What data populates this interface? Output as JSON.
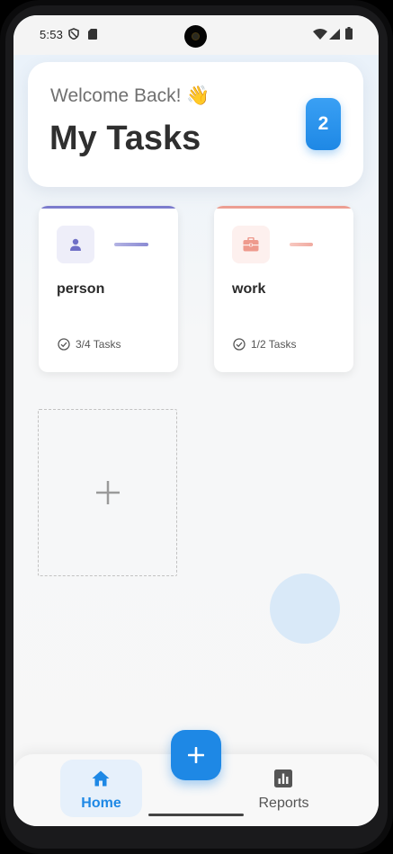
{
  "status_bar": {
    "time": "5:53",
    "left_icons": [
      "shield-icon",
      "sim-card-icon"
    ],
    "right_icons": [
      "wifi-icon",
      "cellular-signal-icon",
      "battery-icon"
    ]
  },
  "header": {
    "welcome": "Welcome Back! 👋",
    "title": "My Tasks",
    "task_count": "2"
  },
  "categories": [
    {
      "name": "person",
      "icon": "person-icon",
      "progress": "3/4 Tasks",
      "completed": 3,
      "total": 4,
      "accent": "#7c7ccd"
    },
    {
      "name": "work",
      "icon": "briefcase-icon",
      "progress": "1/2 Tasks",
      "completed": 1,
      "total": 2,
      "accent": "#ec9e92"
    }
  ],
  "add_category": {
    "icon": "plus-icon"
  },
  "fab": {
    "icon": "plus-icon"
  },
  "bottom_nav": {
    "items": [
      {
        "label": "Home",
        "icon": "home-icon",
        "active": true
      },
      {
        "label": "Reports",
        "icon": "bar-chart-icon",
        "active": false
      }
    ]
  },
  "colors": {
    "primary": "#1e88e5",
    "title_text": "#2f2f2f"
  }
}
